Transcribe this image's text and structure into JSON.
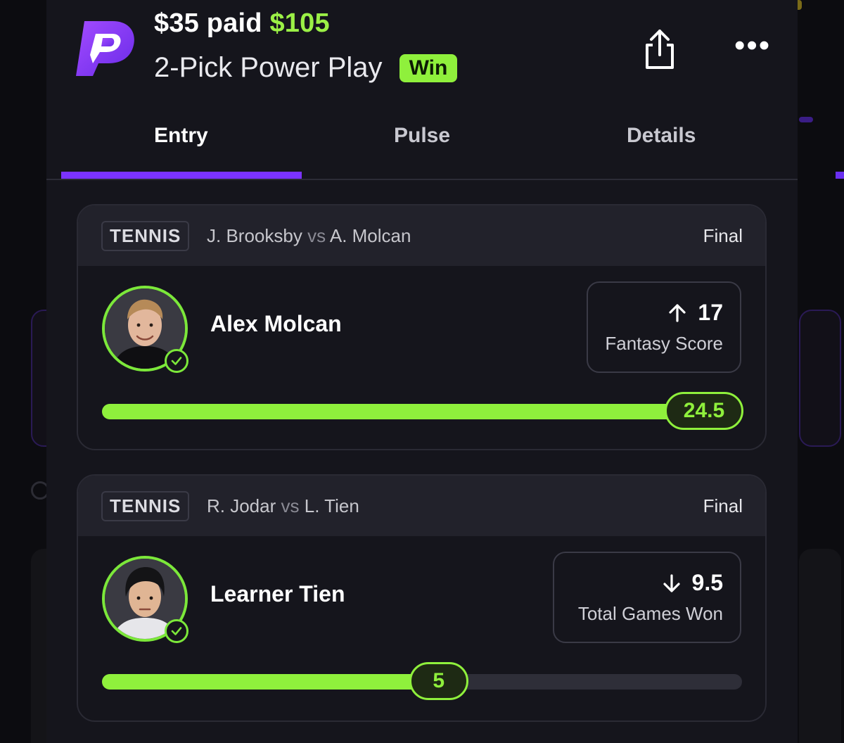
{
  "header": {
    "entry_amount": "$35 paid",
    "payout": "$105",
    "play_type": "2-Pick Power Play",
    "result_badge": "Win",
    "share_icon": "share-icon",
    "more_icon": "more-dots-icon",
    "more_glyph": "•••"
  },
  "tabs": [
    {
      "label": "Entry",
      "active": true
    },
    {
      "label": "Pulse",
      "active": false
    },
    {
      "label": "Details",
      "active": false
    }
  ],
  "picks": [
    {
      "sport": "TENNIS",
      "player_a": "J. Brooksby",
      "vs": "vs",
      "player_b": "A. Molcan",
      "status": "Final",
      "player_name": "Alex Molcan",
      "direction": "up",
      "line": "17",
      "stat_label": "Fantasy Score",
      "result_value": "24.5",
      "progress_fraction": 1.0
    },
    {
      "sport": "TENNIS",
      "player_a": "R. Jodar",
      "vs": "vs",
      "player_b": "L. Tien",
      "status": "Final",
      "player_name": "Learner Tien",
      "direction": "down",
      "line": "9.5",
      "stat_label": "Total Games Won",
      "result_value": "5",
      "progress_fraction": 0.526
    }
  ],
  "colors": {
    "accent_green": "#8ff03c",
    "accent_purple": "#7b33ff",
    "background": "#15151c"
  }
}
